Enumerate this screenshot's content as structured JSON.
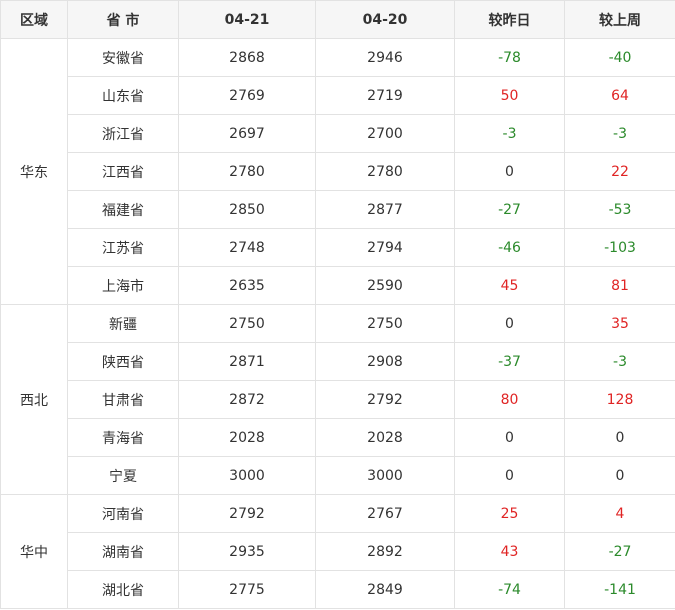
{
  "headers": [
    "区域",
    "省 市",
    "04-21",
    "04-20",
    "较昨日",
    "较上周"
  ],
  "groups": [
    {
      "region": "华东",
      "rows": [
        {
          "province": "安徽省",
          "d21": "2868",
          "d20": "2946",
          "dod": "-78",
          "wow": "-40"
        },
        {
          "province": "山东省",
          "d21": "2769",
          "d20": "2719",
          "dod": "50",
          "wow": "64"
        },
        {
          "province": "浙江省",
          "d21": "2697",
          "d20": "2700",
          "dod": "-3",
          "wow": "-3"
        },
        {
          "province": "江西省",
          "d21": "2780",
          "d20": "2780",
          "dod": "0",
          "wow": "22"
        },
        {
          "province": "福建省",
          "d21": "2850",
          "d20": "2877",
          "dod": "-27",
          "wow": "-53"
        },
        {
          "province": "江苏省",
          "d21": "2748",
          "d20": "2794",
          "dod": "-46",
          "wow": "-103"
        },
        {
          "province": "上海市",
          "d21": "2635",
          "d20": "2590",
          "dod": "45",
          "wow": "81"
        }
      ]
    },
    {
      "region": "西北",
      "rows": [
        {
          "province": "新疆",
          "d21": "2750",
          "d20": "2750",
          "dod": "0",
          "wow": "35"
        },
        {
          "province": "陕西省",
          "d21": "2871",
          "d20": "2908",
          "dod": "-37",
          "wow": "-3"
        },
        {
          "province": "甘肃省",
          "d21": "2872",
          "d20": "2792",
          "dod": "80",
          "wow": "128"
        },
        {
          "province": "青海省",
          "d21": "2028",
          "d20": "2028",
          "dod": "0",
          "wow": "0"
        },
        {
          "province": "宁夏",
          "d21": "3000",
          "d20": "3000",
          "dod": "0",
          "wow": "0"
        }
      ]
    },
    {
      "region": "华中",
      "rows": [
        {
          "province": "河南省",
          "d21": "2792",
          "d20": "2767",
          "dod": "25",
          "wow": "4"
        },
        {
          "province": "湖南省",
          "d21": "2935",
          "d20": "2892",
          "dod": "43",
          "wow": "-27"
        },
        {
          "province": "湖北省",
          "d21": "2775",
          "d20": "2849",
          "dod": "-74",
          "wow": "-141"
        }
      ]
    }
  ],
  "colors": {
    "increase": "#e02424",
    "decrease": "#2b8a2b",
    "neutral": "#333333",
    "header_bg": "#f6f6f6",
    "border": "#e2e2e2"
  }
}
